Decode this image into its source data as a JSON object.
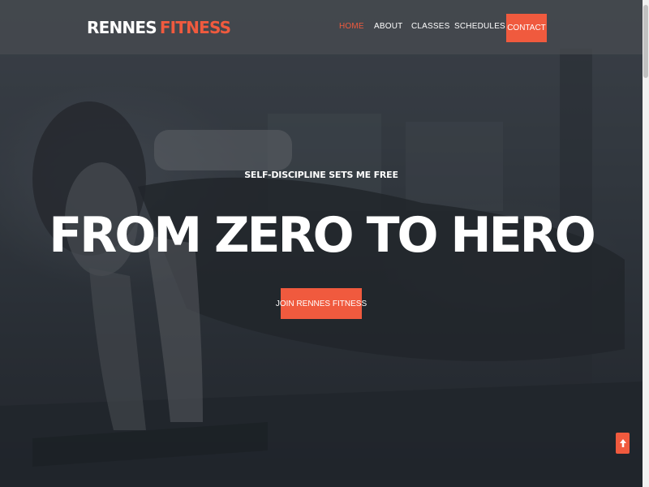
{
  "brand": {
    "part1": "RENNES",
    "part2": "FITNESS",
    "accent_color": "#f05a3e"
  },
  "nav": {
    "items": [
      {
        "label": "HOME",
        "active": true
      },
      {
        "label": "ABOUT",
        "active": false
      },
      {
        "label": "CLASSES",
        "active": false
      },
      {
        "label": "SCHEDULES",
        "active": false
      }
    ],
    "contact_label": "CONTACT"
  },
  "hero": {
    "eyebrow": "SELF-DISCIPLINE SETS ME FREE",
    "title": "FROM ZERO TO HERO",
    "cta_label": "JOIN RENNES FITNESS",
    "background_image": "person-doing-plank-photo"
  },
  "icons": {
    "back_to_top": "arrow-up-icon"
  }
}
